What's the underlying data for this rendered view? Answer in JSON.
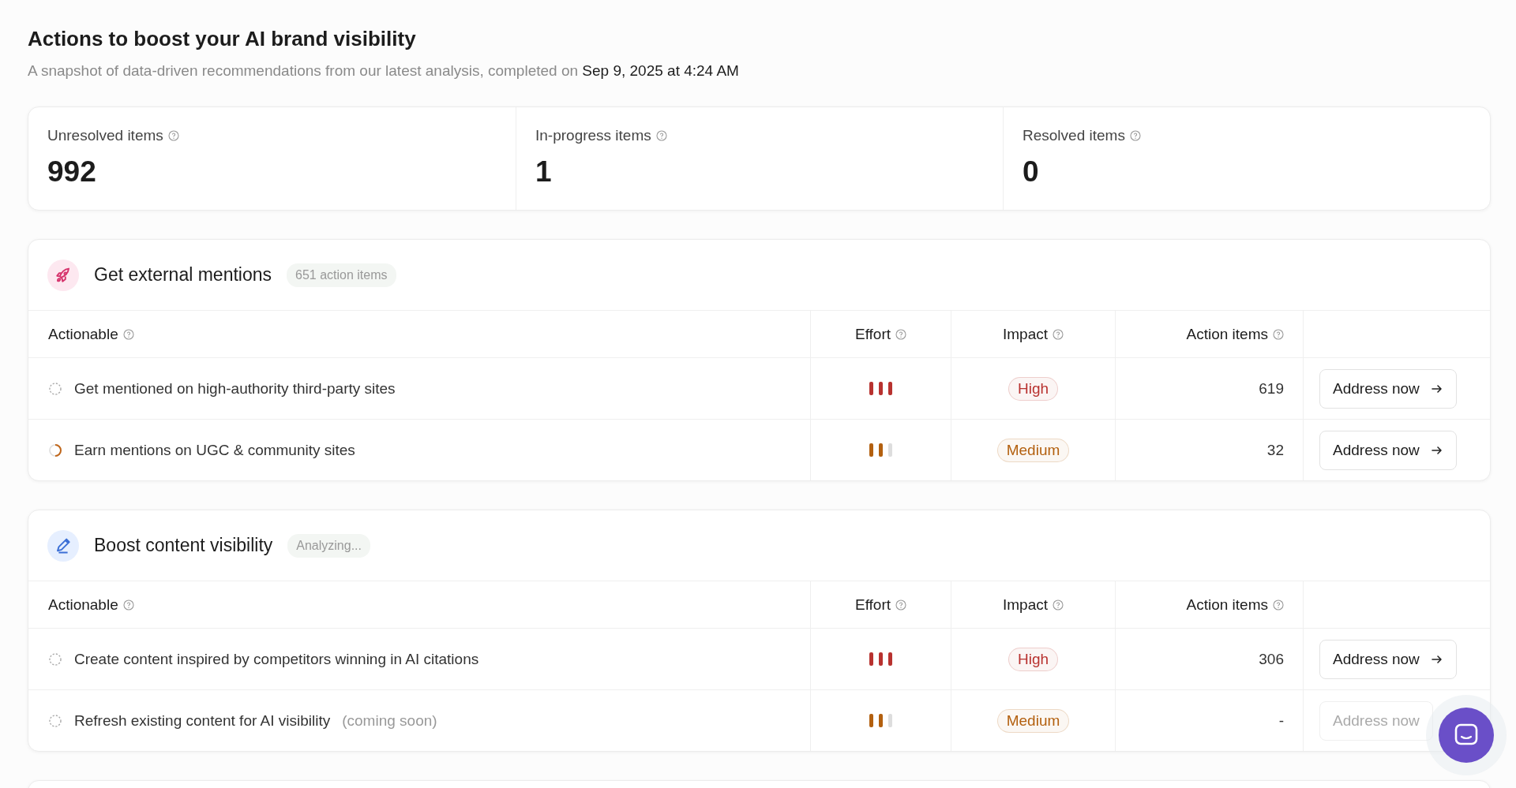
{
  "header": {
    "title": "Actions to boost your AI brand visibility",
    "subtitle": "A snapshot of data-driven recommendations from our latest analysis, completed on **Sep 9, 2025 at 4:24 AM**"
  },
  "stats": [
    {
      "label": "Unresolved items",
      "value": "992"
    },
    {
      "label": "In-progress items",
      "value": "1"
    },
    {
      "label": "Resolved items",
      "value": "0"
    }
  ],
  "sections": [
    {
      "kind": "mentions",
      "title": "Get external mentions",
      "badge": "651 action items",
      "columns": [
        "Actionable",
        "Effort",
        "Impact",
        "Action items"
      ],
      "rows": [
        {
          "in_progress": false,
          "label": "Get mentioned on high-authority third-party sites",
          "effort": {
            "level": 1,
            "color": "#b8322f"
          },
          "impact": {
            "label": "High",
            "color": "#b8322f"
          },
          "count": "619",
          "button": {
            "label": "Address now",
            "disabled": false
          }
        },
        {
          "in_progress": true,
          "label": "Earn mentions on UGC & community sites",
          "effort": {
            "level": 0.6667,
            "color": "#b3600f"
          },
          "impact": {
            "label": "Medium",
            "color": "#b3600f"
          },
          "count": "32",
          "button": {
            "label": "Address now",
            "disabled": false
          }
        }
      ]
    },
    {
      "kind": "content",
      "title": "Boost content visibility",
      "badge": "Analyzing...",
      "columns": [
        "Actionable",
        "Effort",
        "Impact",
        "Action items"
      ],
      "rows": [
        {
          "in_progress": false,
          "label": "Create content inspired by competitors winning in AI citations",
          "effort": {
            "level": 1,
            "color": "#b8322f"
          },
          "impact": {
            "label": "High",
            "color": "#b8322f"
          },
          "count": "306",
          "button": {
            "label": "Address now",
            "disabled": false
          }
        },
        {
          "in_progress": false,
          "label": "Refresh existing content for AI visibility",
          "note": "(coming soon)",
          "effort": {
            "level": 0.6667,
            "color": "#b3600f"
          },
          "impact": {
            "label": "Medium",
            "color": "#b3600f"
          },
          "count": "-",
          "button": {
            "label": "Address now",
            "disabled": true
          }
        }
      ]
    }
  ]
}
